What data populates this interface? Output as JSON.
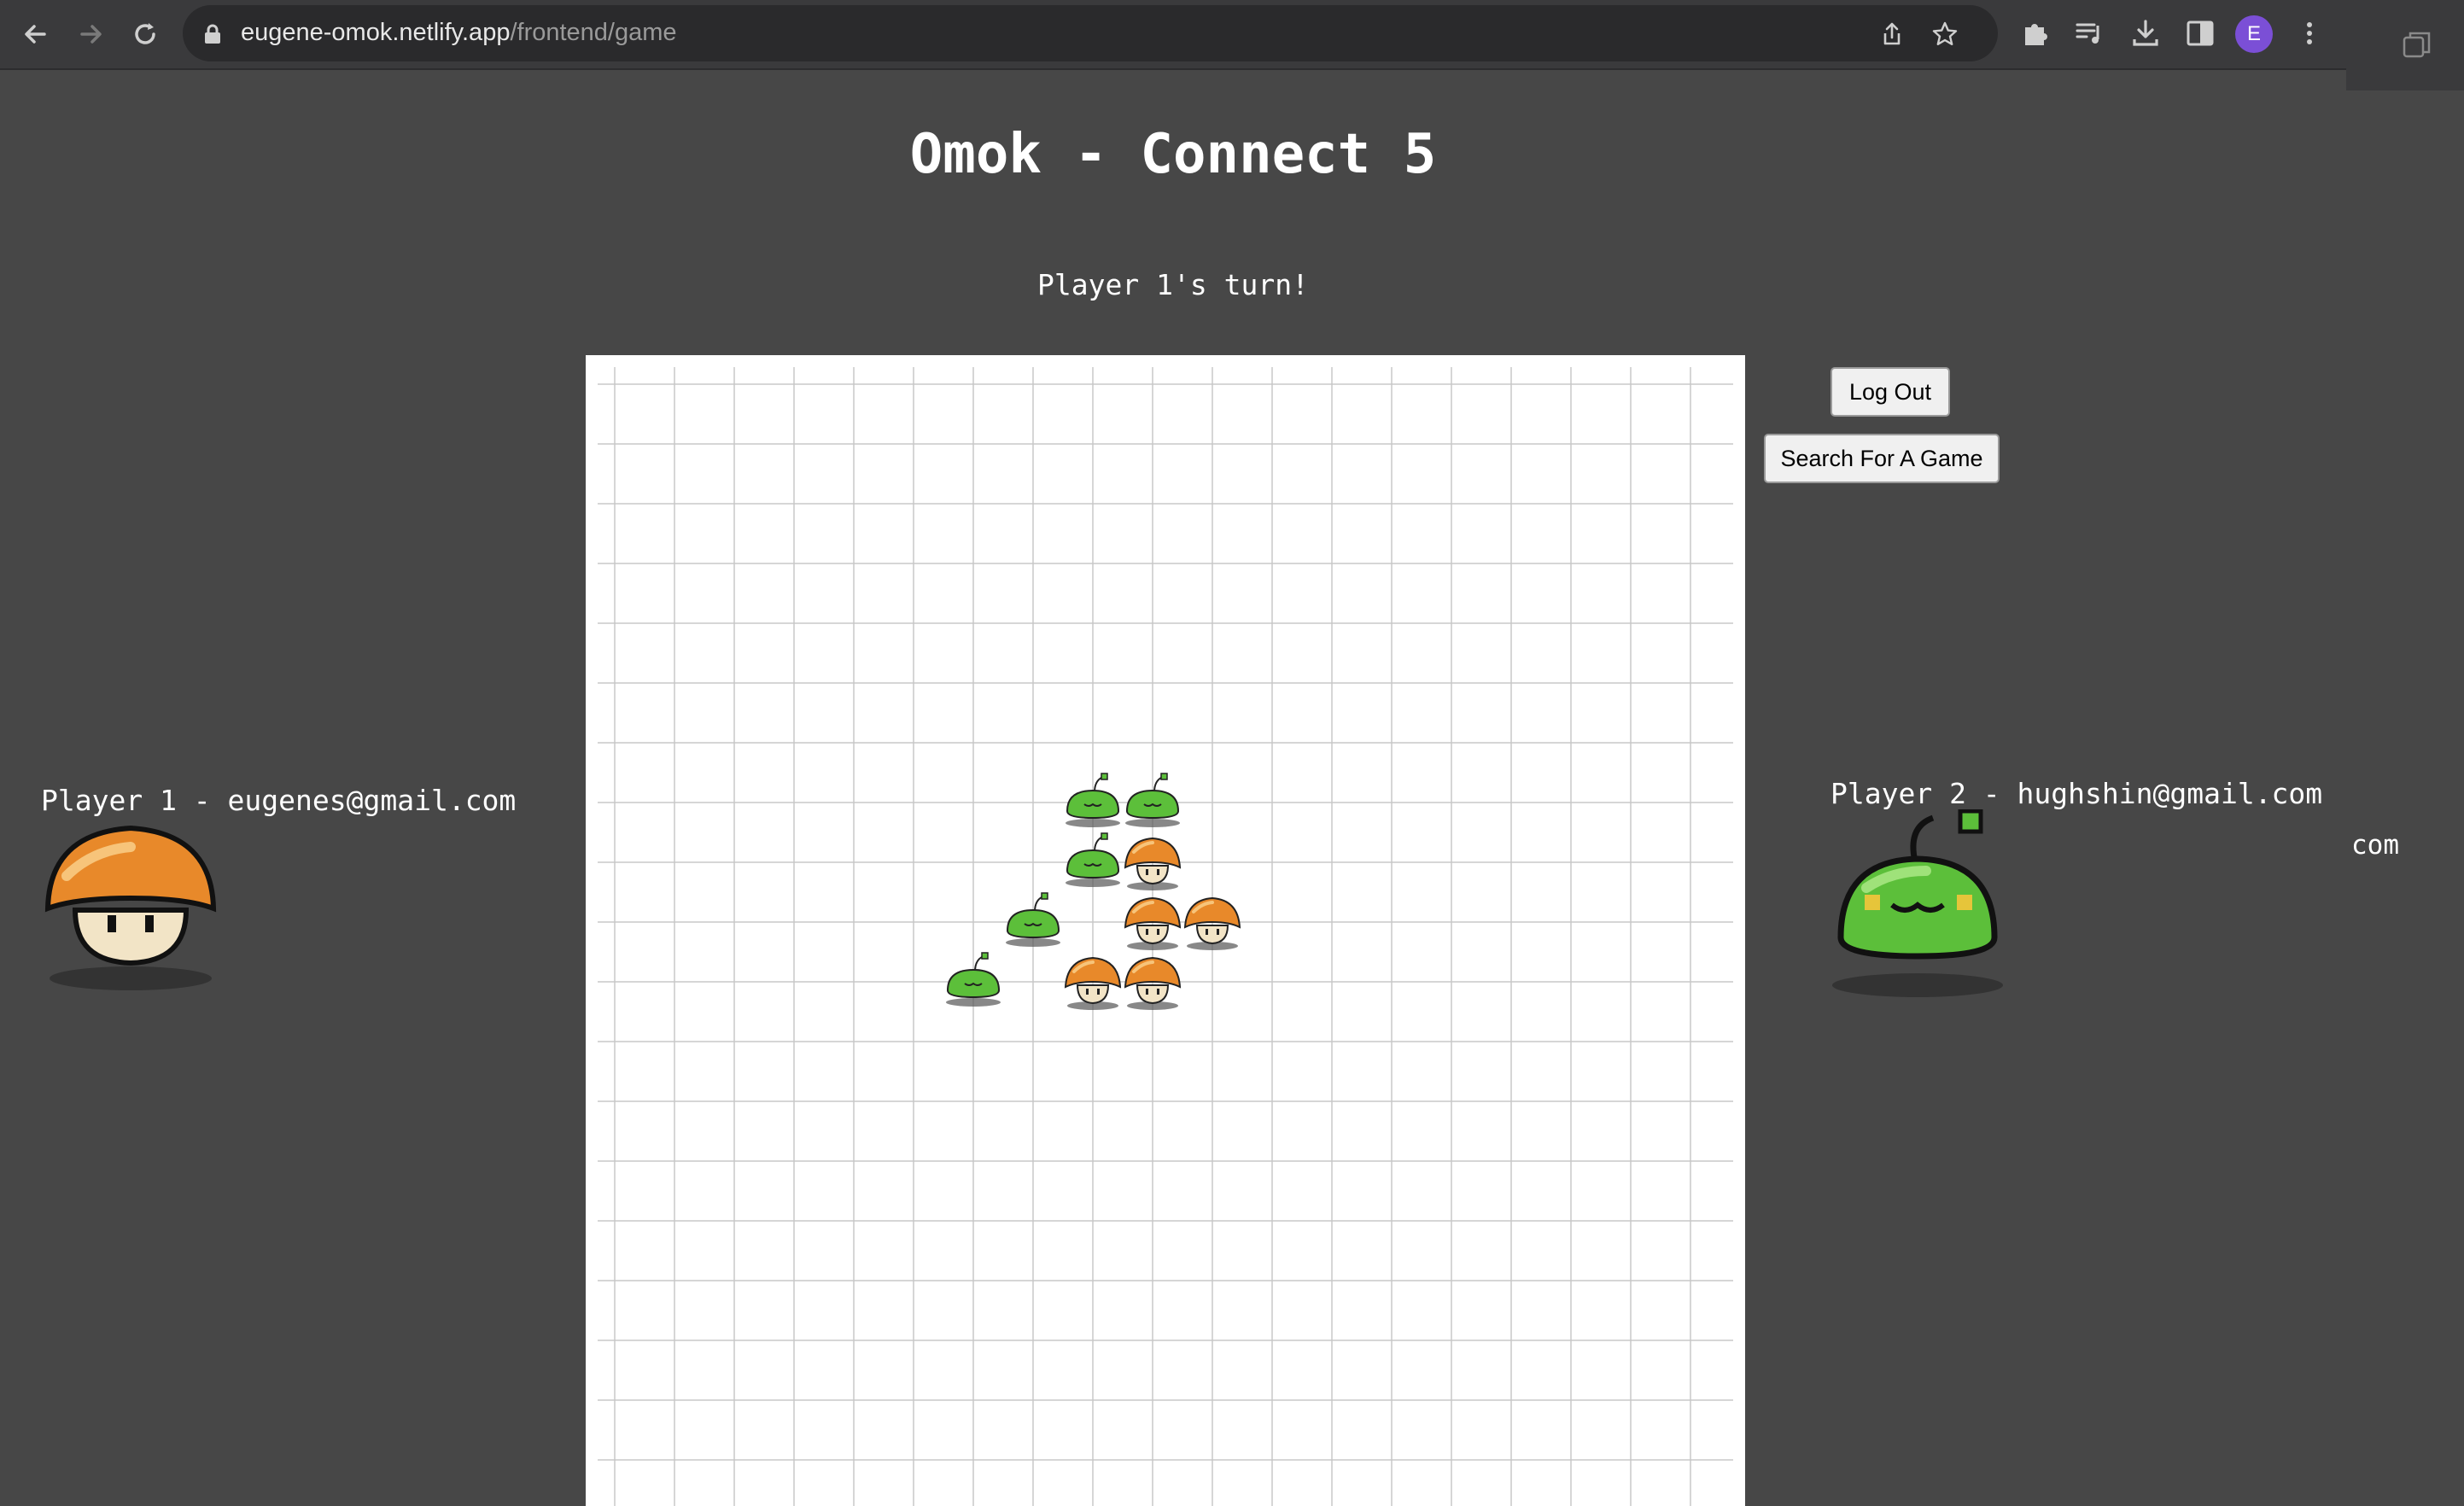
{
  "browser": {
    "url_host": "eugene-omok.netlify.app",
    "url_path": "/frontend/game",
    "profile_initial": "E"
  },
  "page": {
    "title": "Omok - Connect 5",
    "turn_status": "Player 1's turn!"
  },
  "buttons": {
    "logout": "Log Out",
    "search": "Search For A Game"
  },
  "players": {
    "p1": {
      "label": "Player 1 - eugenes@gmail.com",
      "piece": "orange-mushroom"
    },
    "p2": {
      "label": "Player 2 - hughshin@gmail.com",
      "piece": "green-slime"
    }
  },
  "background_window_text": "com",
  "board": {
    "grid_columns": 19,
    "grid_rows": 19,
    "pieces": [
      {
        "col": 8,
        "row": 7,
        "type": "green-slime"
      },
      {
        "col": 9,
        "row": 7,
        "type": "green-slime"
      },
      {
        "col": 8,
        "row": 8,
        "type": "green-slime"
      },
      {
        "col": 9,
        "row": 8,
        "type": "orange-mushroom"
      },
      {
        "col": 7,
        "row": 9,
        "type": "green-slime"
      },
      {
        "col": 9,
        "row": 9,
        "type": "orange-mushroom"
      },
      {
        "col": 10,
        "row": 9,
        "type": "orange-mushroom"
      },
      {
        "col": 6,
        "row": 10,
        "type": "green-slime"
      },
      {
        "col": 8,
        "row": 10,
        "type": "orange-mushroom"
      },
      {
        "col": 9,
        "row": 10,
        "type": "orange-mushroom"
      }
    ]
  },
  "colors": {
    "page_bg": "#474747",
    "board_bg": "#ffffff",
    "grid_line": "#c8c8c8",
    "mushroom_cap": "#e8892a",
    "slime_body": "#5cbf3a"
  }
}
